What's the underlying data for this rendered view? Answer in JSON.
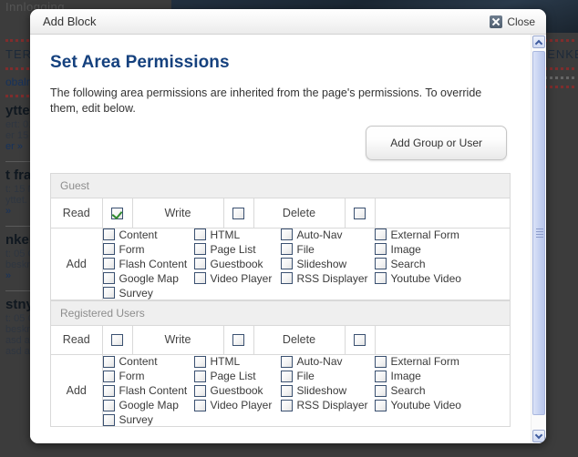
{
  "background": {
    "top_word": "Innlogging",
    "left_lines": [
      "TER",
      "obalm",
      "ytter",
      "ert: 01",
      "er 15 ",
      "er »",
      "t fra",
      "t: 15 N",
      "yttet. ",
      "»",
      "nkel",
      "t: 05 O",
      "beskri",
      "»",
      "stny",
      "t: 05 O",
      "beskri",
      " asd as",
      "sd as asd as asd"
    ],
    "right_label": "LENKE",
    "bottom_text": "asd as asd as asd"
  },
  "dialog": {
    "title": "Add Block",
    "close_label": "Close",
    "heading": "Set Area Permissions",
    "intro": "The following area permissions are inherited from the page's permissions. To override them, edit below.",
    "add_group_button": "Add Group or User"
  },
  "labels": {
    "read": "Read",
    "write": "Write",
    "delete": "Delete",
    "add": "Add"
  },
  "block_types": [
    "Content",
    "HTML",
    "Auto-Nav",
    "External Form",
    "Form",
    "Page List",
    "File",
    "Image",
    "Flash Content",
    "Guestbook",
    "Slideshow",
    "Search",
    "Google Map",
    "Video Player",
    "RSS Displayer",
    "Youtube Video",
    "Survey"
  ],
  "groups": [
    {
      "name": "Guest",
      "read": true,
      "write": false,
      "delete": false
    },
    {
      "name": "Registered Users",
      "read": false,
      "write": false,
      "delete": false
    }
  ],
  "colors": {
    "heading": "#15417e",
    "check": "#2f8a2f",
    "scrollbar": "#c4d0f0"
  }
}
